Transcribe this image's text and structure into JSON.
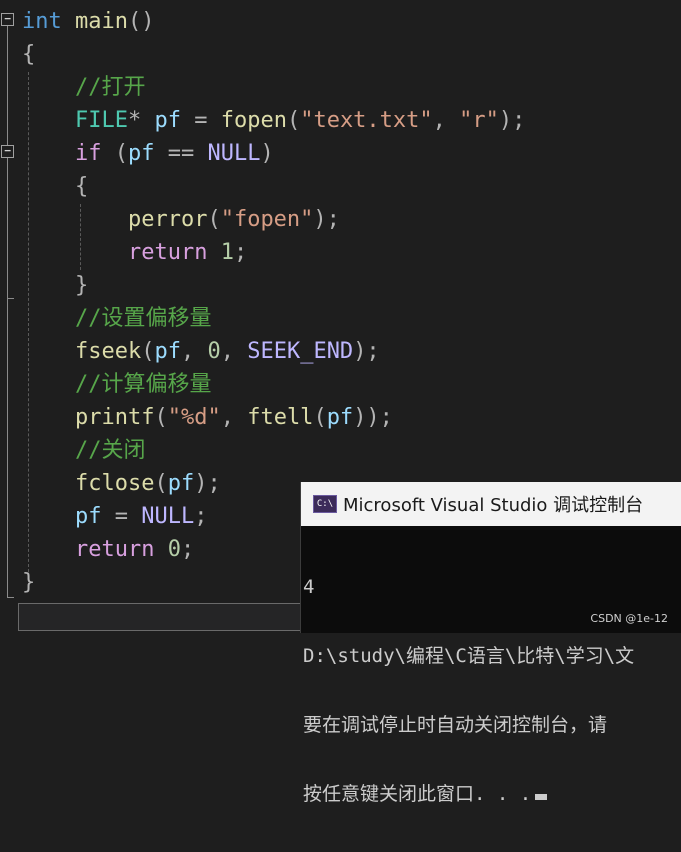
{
  "code": {
    "lines": [
      [
        {
          "t": "int",
          "c": "kw"
        },
        {
          "t": " main",
          "c": "fn"
        },
        {
          "t": "()",
          "c": "op"
        }
      ],
      [
        {
          "t": "{",
          "c": "op"
        }
      ],
      [
        {
          "t": "    //打开",
          "c": "cm"
        }
      ],
      [
        {
          "t": "    ",
          "c": ""
        },
        {
          "t": "FILE",
          "c": "typ"
        },
        {
          "t": "* ",
          "c": "op"
        },
        {
          "t": "pf",
          "c": "var"
        },
        {
          "t": " = ",
          "c": "op"
        },
        {
          "t": "fopen",
          "c": "fn"
        },
        {
          "t": "(",
          "c": "op"
        },
        {
          "t": "\"text.txt\"",
          "c": "str"
        },
        {
          "t": ", ",
          "c": "op"
        },
        {
          "t": "\"r\"",
          "c": "str"
        },
        {
          "t": ");",
          "c": "op"
        }
      ],
      [
        {
          "t": "    ",
          "c": ""
        },
        {
          "t": "if",
          "c": "kwc"
        },
        {
          "t": " (",
          "c": "op"
        },
        {
          "t": "pf",
          "c": "var"
        },
        {
          "t": " == ",
          "c": "op"
        },
        {
          "t": "NULL",
          "c": "mac"
        },
        {
          "t": ")",
          "c": "op"
        }
      ],
      [
        {
          "t": "    {",
          "c": "op"
        }
      ],
      [
        {
          "t": "        ",
          "c": ""
        },
        {
          "t": "perror",
          "c": "fn"
        },
        {
          "t": "(",
          "c": "op"
        },
        {
          "t": "\"fopen\"",
          "c": "str"
        },
        {
          "t": ");",
          "c": "op"
        }
      ],
      [
        {
          "t": "        ",
          "c": ""
        },
        {
          "t": "return",
          "c": "kwc"
        },
        {
          "t": " ",
          "c": ""
        },
        {
          "t": "1",
          "c": "num"
        },
        {
          "t": ";",
          "c": "op"
        }
      ],
      [
        {
          "t": "    }",
          "c": "op"
        }
      ],
      [
        {
          "t": "    //设置偏移量",
          "c": "cm"
        }
      ],
      [
        {
          "t": "    ",
          "c": ""
        },
        {
          "t": "fseek",
          "c": "fn"
        },
        {
          "t": "(",
          "c": "op"
        },
        {
          "t": "pf",
          "c": "var"
        },
        {
          "t": ", ",
          "c": "op"
        },
        {
          "t": "0",
          "c": "num"
        },
        {
          "t": ", ",
          "c": "op"
        },
        {
          "t": "SEEK_END",
          "c": "mac"
        },
        {
          "t": ");",
          "c": "op"
        }
      ],
      [
        {
          "t": "    //计算偏移量",
          "c": "cm"
        }
      ],
      [
        {
          "t": "    ",
          "c": ""
        },
        {
          "t": "printf",
          "c": "fn"
        },
        {
          "t": "(",
          "c": "op"
        },
        {
          "t": "\"%d\"",
          "c": "str"
        },
        {
          "t": ", ",
          "c": "op"
        },
        {
          "t": "ftell",
          "c": "fn"
        },
        {
          "t": "(",
          "c": "op"
        },
        {
          "t": "pf",
          "c": "var"
        },
        {
          "t": "));",
          "c": "op"
        }
      ],
      [
        {
          "t": "    //关闭",
          "c": "cm"
        }
      ],
      [
        {
          "t": "    ",
          "c": ""
        },
        {
          "t": "fclose",
          "c": "fn"
        },
        {
          "t": "(",
          "c": "op"
        },
        {
          "t": "pf",
          "c": "var"
        },
        {
          "t": ");",
          "c": "op"
        }
      ],
      [
        {
          "t": "    ",
          "c": ""
        },
        {
          "t": "pf",
          "c": "var"
        },
        {
          "t": " = ",
          "c": "op"
        },
        {
          "t": "NULL",
          "c": "mac"
        },
        {
          "t": ";",
          "c": "op"
        }
      ],
      [
        {
          "t": "    ",
          "c": ""
        },
        {
          "t": "return",
          "c": "kwc"
        },
        {
          "t": " ",
          "c": ""
        },
        {
          "t": "0",
          "c": "num"
        },
        {
          "t": ";",
          "c": "op"
        }
      ],
      [
        {
          "t": "}",
          "c": "op"
        }
      ]
    ]
  },
  "fold_markers": [
    "−",
    "−"
  ],
  "console": {
    "icon_text": "C:\\",
    "title": "Microsoft Visual Studio 调试控制台",
    "output": [
      "4",
      "D:\\study\\编程\\C语言\\比特\\学习\\文",
      "要在调试停止时自动关闭控制台，请",
      "按任意键关闭此窗口. . ."
    ]
  },
  "watermark": "CSDN @1e-12"
}
